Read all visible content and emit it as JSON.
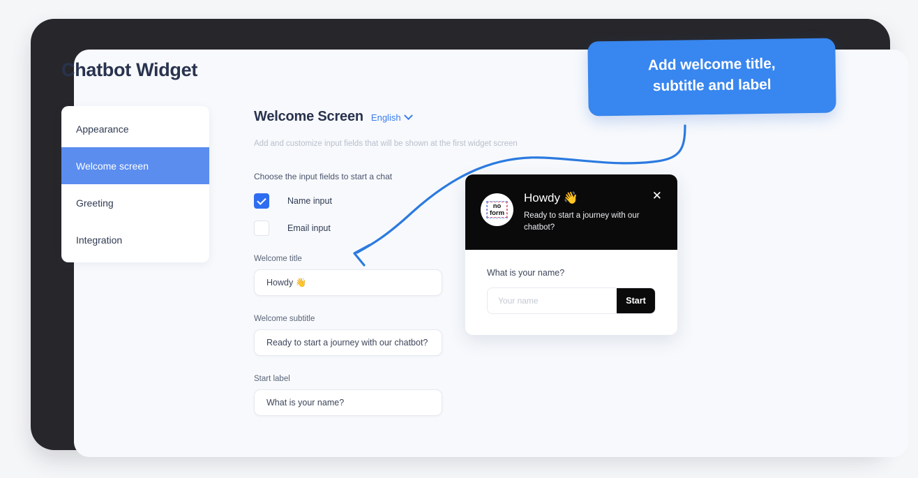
{
  "page": {
    "title": "Chatbot Widget"
  },
  "sidebar": {
    "items": [
      {
        "label": "Appearance",
        "active": false
      },
      {
        "label": "Welcome screen",
        "active": true
      },
      {
        "label": "Greeting",
        "active": false
      },
      {
        "label": "Integration",
        "active": false
      }
    ]
  },
  "main": {
    "section_title": "Welcome Screen",
    "language": "English",
    "description": "Add and customize input fields that will be shown at the first widget screen",
    "fields_label": "Choose the input fields to start a chat",
    "checkboxes": [
      {
        "label": "Name input",
        "checked": true
      },
      {
        "label": "Email input",
        "checked": false
      }
    ],
    "form_fields": [
      {
        "label": "Welcome title",
        "value": "Howdy 👋"
      },
      {
        "label": "Welcome subtitle",
        "value": "Ready to start a journey with our chatbot?"
      },
      {
        "label": "Start label",
        "value": "What is your name?"
      }
    ]
  },
  "widget_preview": {
    "avatar_line1": "no",
    "avatar_line2": "form",
    "title": "Howdy 👋",
    "subtitle": "Ready to start a journey with our chatbot?",
    "close_label": "✕",
    "question": "What is your name?",
    "input_placeholder": "Your name",
    "start_button": "Start"
  },
  "callout": {
    "line1": "Add welcome title,",
    "line2": "subtitle and label"
  },
  "colors": {
    "accent_blue": "#3886ef",
    "sidebar_active": "#5b8def",
    "checkbox_blue": "#2f6df0",
    "link_blue": "#3b7ded",
    "widget_dark": "#0a0a0a",
    "frame_dark": "#27272b",
    "page_bg": "#f5f6f8",
    "screen_bg": "#f7f9fc",
    "title_text": "#29334e"
  }
}
